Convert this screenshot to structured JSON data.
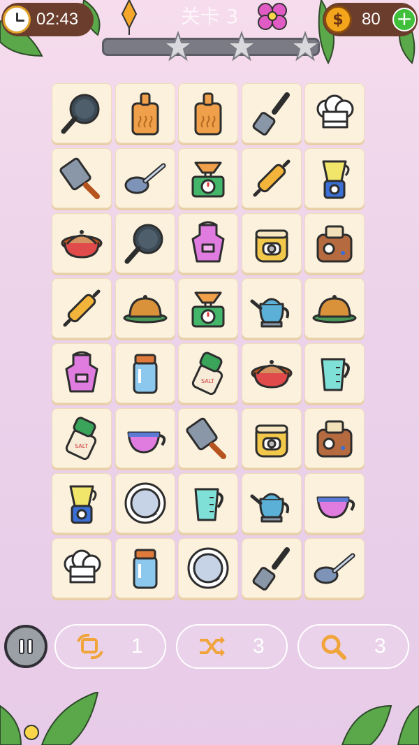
{
  "hud": {
    "timer": "02:43",
    "level_title": "关卡 3",
    "coins": "80",
    "add_symbol": "+",
    "coin_symbol": "$",
    "stars_total": 3
  },
  "board": {
    "rows": 8,
    "cols": 5,
    "tiles": [
      [
        "frying-pan",
        "cutting-board",
        "cutting-board",
        "spatula",
        "chef-hat"
      ],
      [
        "cleaver",
        "ladle-spoon",
        "kitchen-scale",
        "rolling-pin",
        "blender"
      ],
      [
        "casserole-pot",
        "frying-pan",
        "apron",
        "rice-cooker",
        "toaster"
      ],
      [
        "rolling-pin",
        "cloche-dish",
        "kitchen-scale",
        "kettle",
        "cloche-dish"
      ],
      [
        "apron",
        "glass-jar",
        "salt-shaker",
        "casserole-pot",
        "measuring-cup"
      ],
      [
        "salt-shaker",
        "teacup",
        "cleaver",
        "rice-cooker",
        "toaster"
      ],
      [
        "blender",
        "plate",
        "measuring-cup",
        "kettle",
        "teacup"
      ],
      [
        "chef-hat",
        "glass-jar",
        "plate",
        "spatula",
        "ladle-spoon"
      ]
    ]
  },
  "controls": {
    "rotate_count": "1",
    "shuffle_count": "3",
    "hint_count": "3"
  },
  "colors": {
    "tile_bg": "#fbf1dc",
    "hud_bg": "#6b3d2c",
    "accent_orange": "#f0a43a"
  }
}
